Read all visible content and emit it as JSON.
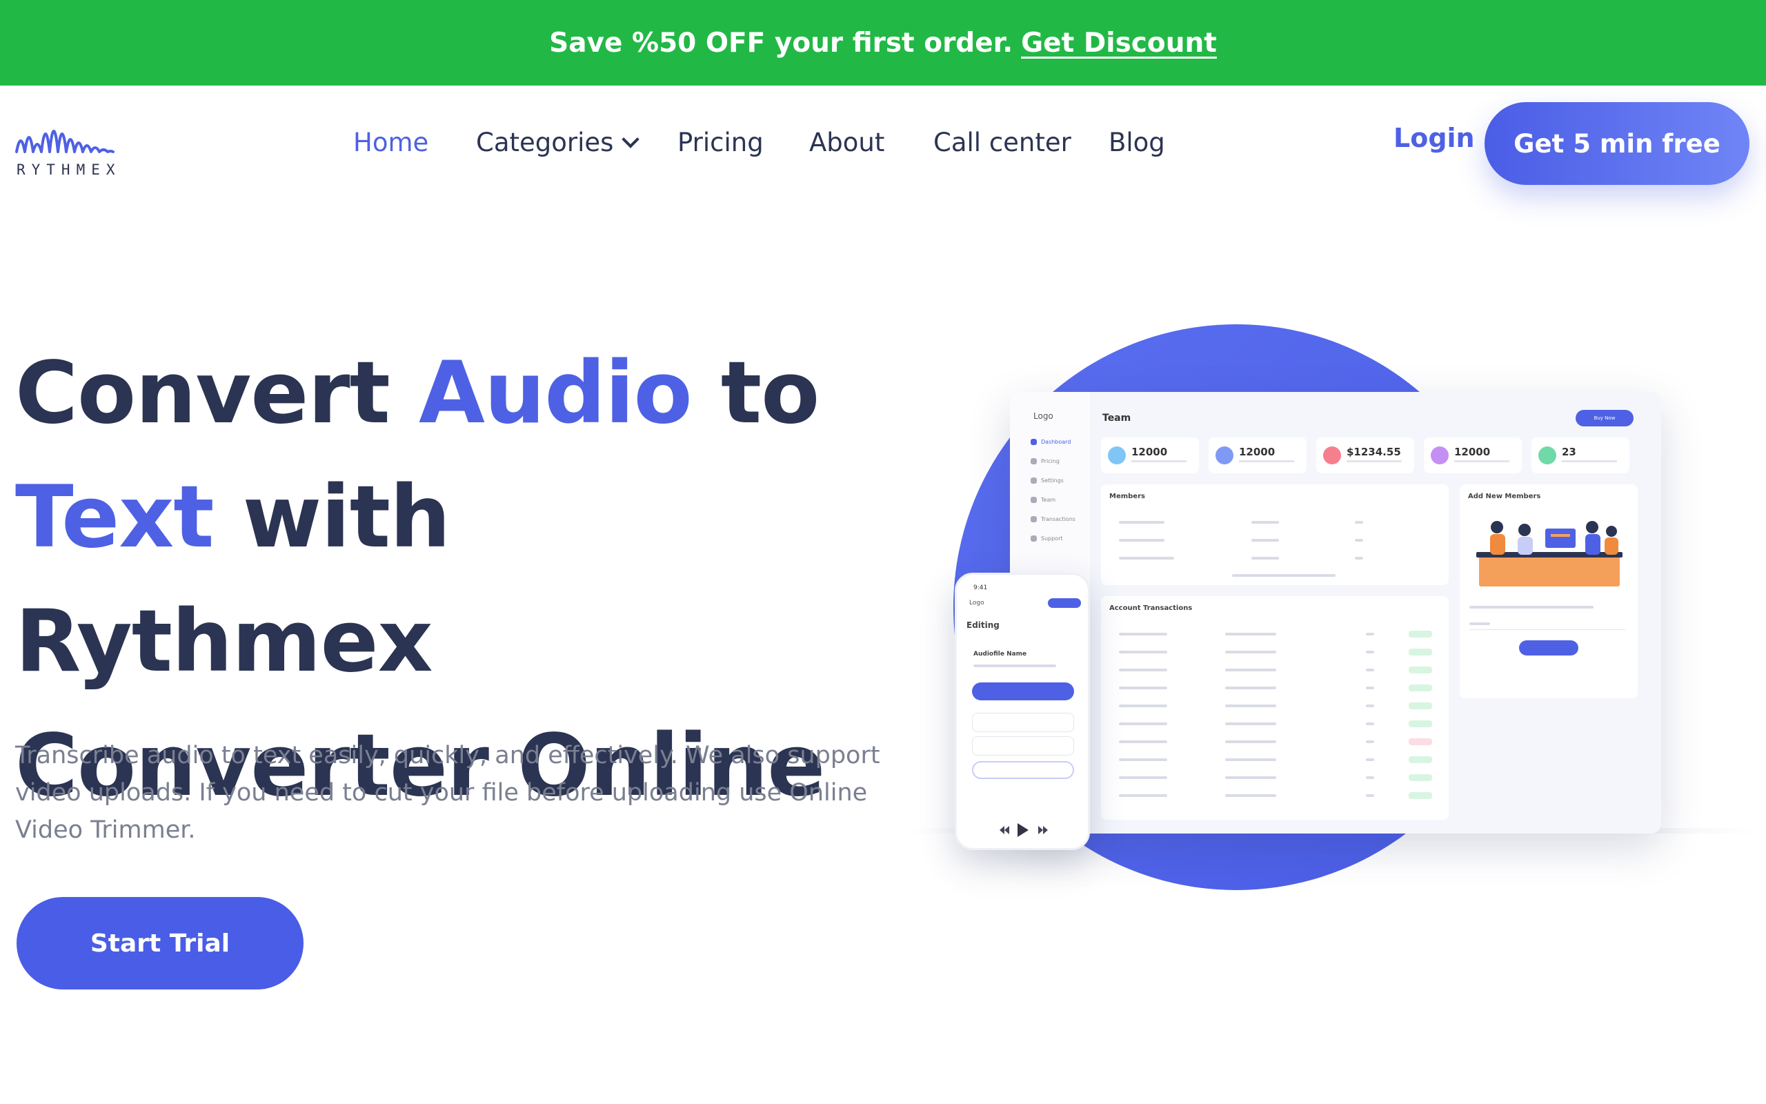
{
  "promo": {
    "text": "Save %50 OFF your first order.",
    "link": "Get Discount"
  },
  "brand": {
    "name": "RYTHMEX"
  },
  "nav": {
    "items": [
      {
        "label": "Home",
        "active": true
      },
      {
        "label": "Categories",
        "has_dropdown": true
      },
      {
        "label": "Pricing"
      },
      {
        "label": "About"
      },
      {
        "label": "Call center"
      },
      {
        "label": "Blog"
      }
    ],
    "login": "Login",
    "cta": "Get 5 min free"
  },
  "hero": {
    "title_parts": [
      "Convert ",
      "Audio",
      " to",
      "Text",
      " with Rythmex",
      "Converter Online"
    ],
    "description": "Transcribe audio to text easily, quickly, and effectively. We also support video uploads. If you need to cut your file before uploading use Online Video Trimmer.",
    "button": "Start Trial"
  },
  "illustration": {
    "dashboard": {
      "logo": "Logo",
      "title": "Team",
      "buy_label": "Buy Now",
      "sidebar": [
        "Dashboard",
        "Pricing",
        "Settings",
        "Team",
        "Transactions",
        "Support"
      ],
      "stats": [
        "12000",
        "12000",
        "$1234.55",
        "12000",
        "23"
      ],
      "members_title": "Members",
      "add_members_title": "Add New Members",
      "transactions_title": "Account Transactions"
    },
    "phone": {
      "time": "9:41",
      "logo": "Logo",
      "title": "Editing",
      "file_name": "Audiofile Name"
    }
  },
  "colors": {
    "promo_green": "#22b846",
    "accent": "#4e61e4",
    "text_dark": "#2b3452",
    "text_muted": "#7a7f91"
  }
}
